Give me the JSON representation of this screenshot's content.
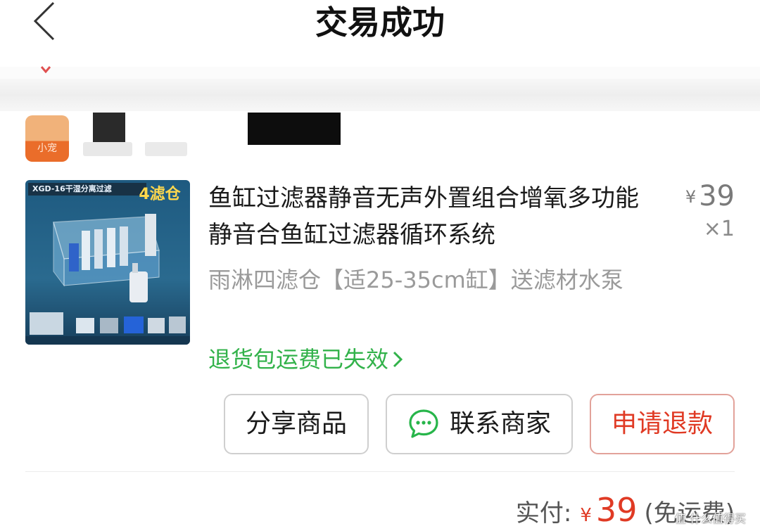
{
  "nav": {
    "title": "交易成功",
    "back_icon": "chevron-left-icon"
  },
  "shop": {
    "logo_text": "小宠"
  },
  "product": {
    "thumbnail": {
      "banner": "XGD-16干湿分离过滤",
      "badge": "4滤仓"
    },
    "title": "鱼缸过滤器静音无声外置组合增氧多功能静音合鱼缸过滤器循环系统",
    "price_symbol": "¥",
    "price": "39",
    "quantity": "×1",
    "spec": "雨淋四滤仓【适25-35cm缸】送滤材水泵",
    "return_link": "退货包运费已失效"
  },
  "actions": {
    "share_label": "分享商品",
    "contact_label": "联系商家",
    "refund_label": "申请退款"
  },
  "payment": {
    "label": "实付:",
    "symbol": "¥",
    "amount": "39",
    "note": "(免运费)"
  },
  "watermark": "值 什么值得买",
  "colors": {
    "accent_red": "#e03a24",
    "link_green": "#32b24a",
    "chat_green": "#27b54a"
  }
}
